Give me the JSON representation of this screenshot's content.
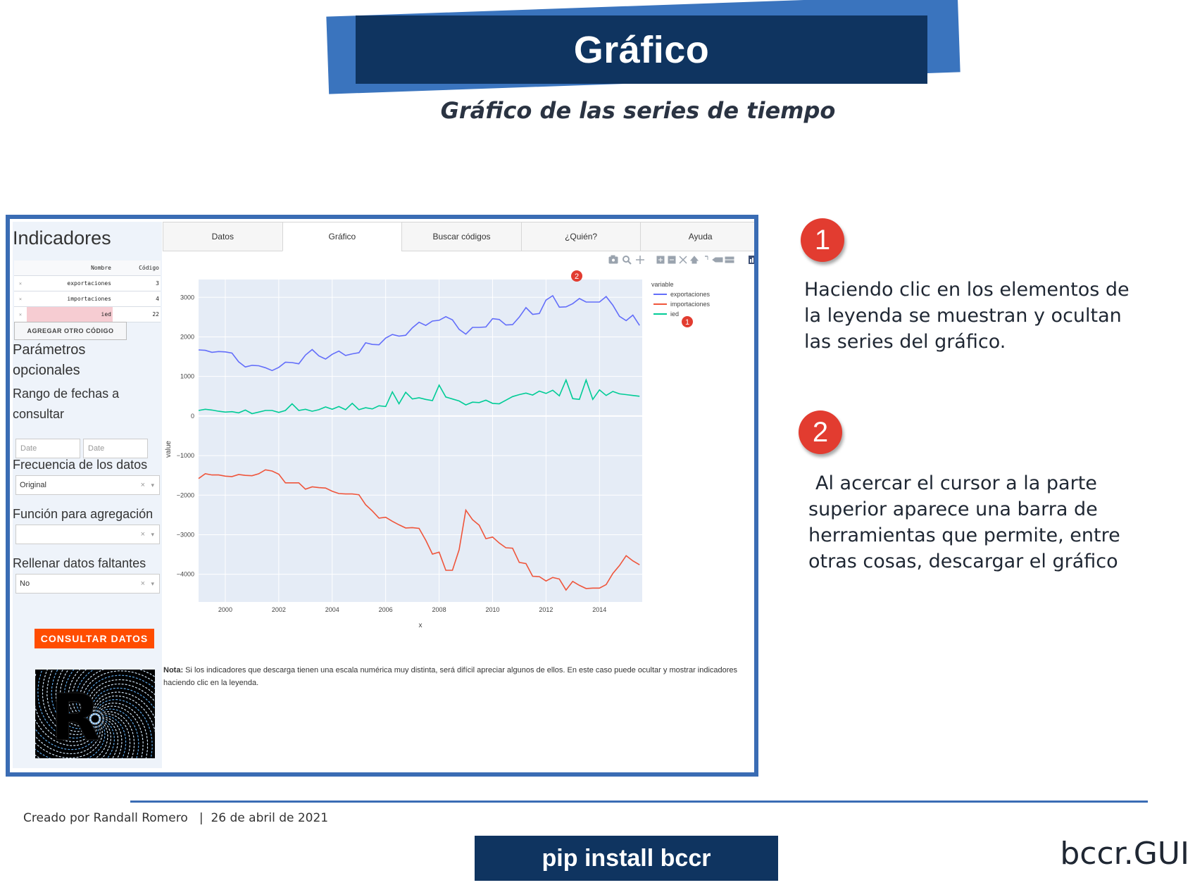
{
  "header": {
    "title": "Gráfico",
    "subtitle": "Gráfico de las series de tiempo"
  },
  "sidebar": {
    "heading": "Indicadores",
    "table": {
      "headers": [
        "Nombre",
        "Código"
      ],
      "rows": [
        {
          "remove": "×",
          "nombre": "exportaciones",
          "codigo": "3"
        },
        {
          "remove": "×",
          "nombre": "importaciones",
          "codigo": "4"
        },
        {
          "remove": "×",
          "nombre": "ied",
          "codigo": "22"
        }
      ]
    },
    "add_code_label": "AGREGAR OTRO CÓDIGO",
    "optional_params": "Parámetros opcionales",
    "date_range_label": "Rango de fechas a consultar",
    "date_start_placeholder": "Date",
    "date_end_placeholder": "Date",
    "frequency_label": "Frecuencia de los datos",
    "frequency_value": "Original",
    "aggregation_label": "Función para agregación",
    "aggregation_value": "",
    "fill_label": "Rellenar datos faltantes",
    "fill_value": "No",
    "clear_glyph": "×",
    "caret_glyph": "▾",
    "query_label": "CONSULTAR DATOS"
  },
  "tabs": [
    "Datos",
    "Gráfico",
    "Buscar códigos",
    "¿Quién?",
    "Ayuda"
  ],
  "active_tab": "Gráfico",
  "modebar_icons": [
    "camera-icon",
    "zoom-icon",
    "pan-icon",
    "zoom-in-icon",
    "zoom-out-icon",
    "autoscale-icon",
    "reset-axes-icon",
    "spike-lines-icon",
    "hover-closest-icon",
    "hover-compare-icon",
    "plotly-logo-icon"
  ],
  "callout_badges": {
    "modebar": "2",
    "legend": "1"
  },
  "note": {
    "bold": "Nota:",
    "text": " Si los indicadores que descarga tienen una escala numérica muy distinta, será difícil apreciar algunos de ellos. En este caso puede ocultar y mostrar indicadores haciendo clic en la leyenda."
  },
  "chart_data": {
    "type": "line",
    "xlabel": "x",
    "ylabel": "value",
    "legend_title": "variable",
    "xlim": [
      1999,
      2015.6
    ],
    "ylim": [
      -4700,
      3450
    ],
    "x_ticks": [
      "2000",
      "2002",
      "2004",
      "2006",
      "2008",
      "2010",
      "2012",
      "2014"
    ],
    "y_ticks": [
      "3000",
      "2000",
      "1000",
      "0",
      "−1000",
      "−2000",
      "−3000",
      "−4000"
    ],
    "grid": true,
    "legend_position": "top-right",
    "series": [
      {
        "name": "exportaciones",
        "color": "#636efa",
        "x": [
          1999.0,
          1999.25,
          1999.5,
          1999.75,
          2000.0,
          2000.25,
          2000.5,
          2000.75,
          2001.0,
          2001.25,
          2001.5,
          2001.75,
          2002.0,
          2002.25,
          2002.5,
          2002.75,
          2003.0,
          2003.25,
          2003.5,
          2003.75,
          2004.0,
          2004.25,
          2004.5,
          2004.75,
          2005.0,
          2005.25,
          2005.5,
          2005.75,
          2006.0,
          2006.25,
          2006.5,
          2006.75,
          2007.0,
          2007.25,
          2007.5,
          2007.75,
          2008.0,
          2008.25,
          2008.5,
          2008.75,
          2009.0,
          2009.25,
          2009.5,
          2009.75,
          2010.0,
          2010.25,
          2010.5,
          2010.75,
          2011.0,
          2011.25,
          2011.5,
          2011.75,
          2012.0,
          2012.25,
          2012.5,
          2012.75,
          2013.0,
          2013.25,
          2013.5,
          2013.75,
          2014.0,
          2014.25,
          2014.5,
          2014.75,
          2015.0,
          2015.25,
          2015.5
        ],
        "y": [
          1670,
          1660,
          1610,
          1630,
          1620,
          1590,
          1370,
          1240,
          1280,
          1270,
          1220,
          1150,
          1230,
          1360,
          1350,
          1320,
          1540,
          1680,
          1520,
          1440,
          1560,
          1640,
          1530,
          1570,
          1600,
          1850,
          1810,
          1800,
          1970,
          2060,
          2020,
          2040,
          2230,
          2370,
          2290,
          2400,
          2420,
          2510,
          2430,
          2190,
          2070,
          2240,
          2240,
          2250,
          2460,
          2440,
          2300,
          2310,
          2500,
          2740,
          2570,
          2590,
          2930,
          3040,
          2750,
          2760,
          2840,
          2970,
          2880,
          2880,
          2880,
          3020,
          2800,
          2520,
          2410,
          2550,
          2290
        ]
      },
      {
        "name": "importaciones",
        "color": "#ef553b",
        "x": [
          1999.0,
          1999.25,
          1999.5,
          1999.75,
          2000.0,
          2000.25,
          2000.5,
          2000.75,
          2001.0,
          2001.25,
          2001.5,
          2001.75,
          2002.0,
          2002.25,
          2002.5,
          2002.75,
          2003.0,
          2003.25,
          2003.5,
          2003.75,
          2004.0,
          2004.25,
          2004.5,
          2004.75,
          2005.0,
          2005.25,
          2005.5,
          2005.75,
          2006.0,
          2006.25,
          2006.5,
          2006.75,
          2007.0,
          2007.25,
          2007.5,
          2007.75,
          2008.0,
          2008.25,
          2008.5,
          2008.75,
          2009.0,
          2009.25,
          2009.5,
          2009.75,
          2010.0,
          2010.25,
          2010.5,
          2010.75,
          2011.0,
          2011.25,
          2011.5,
          2011.75,
          2012.0,
          2012.25,
          2012.5,
          2012.75,
          2013.0,
          2013.25,
          2013.5,
          2013.75,
          2014.0,
          2014.25,
          2014.5,
          2014.75,
          2015.0,
          2015.25,
          2015.5
        ],
        "y": [
          -1580,
          -1460,
          -1490,
          -1490,
          -1520,
          -1530,
          -1480,
          -1500,
          -1510,
          -1460,
          -1360,
          -1390,
          -1470,
          -1690,
          -1690,
          -1690,
          -1850,
          -1790,
          -1810,
          -1820,
          -1900,
          -1960,
          -1970,
          -1970,
          -1990,
          -2240,
          -2400,
          -2580,
          -2560,
          -2660,
          -2750,
          -2830,
          -2820,
          -2840,
          -3140,
          -3490,
          -3440,
          -3900,
          -3900,
          -3380,
          -2380,
          -2620,
          -2760,
          -3100,
          -3060,
          -3210,
          -3330,
          -3340,
          -3700,
          -3730,
          -4050,
          -4060,
          -4170,
          -4080,
          -4120,
          -4400,
          -4180,
          -4280,
          -4360,
          -4350,
          -4350,
          -4260,
          -3980,
          -3780,
          -3530,
          -3660,
          -3760
        ]
      },
      {
        "name": "ied",
        "color": "#00cc96",
        "x": [
          1999.0,
          1999.25,
          1999.5,
          1999.75,
          2000.0,
          2000.25,
          2000.5,
          2000.75,
          2001.0,
          2001.25,
          2001.5,
          2001.75,
          2002.0,
          2002.25,
          2002.5,
          2002.75,
          2003.0,
          2003.25,
          2003.5,
          2003.75,
          2004.0,
          2004.25,
          2004.5,
          2004.75,
          2005.0,
          2005.25,
          2005.5,
          2005.75,
          2006.0,
          2006.25,
          2006.5,
          2006.75,
          2007.0,
          2007.25,
          2007.5,
          2007.75,
          2008.0,
          2008.25,
          2008.5,
          2008.75,
          2009.0,
          2009.25,
          2009.5,
          2009.75,
          2010.0,
          2010.25,
          2010.5,
          2010.75,
          2011.0,
          2011.25,
          2011.5,
          2011.75,
          2012.0,
          2012.25,
          2012.5,
          2012.75,
          2013.0,
          2013.25,
          2013.5,
          2013.75,
          2014.0,
          2014.25,
          2014.5,
          2014.75,
          2015.0,
          2015.25,
          2015.5
        ],
        "y": [
          140,
          170,
          150,
          120,
          100,
          110,
          80,
          150,
          60,
          100,
          140,
          140,
          90,
          140,
          310,
          140,
          170,
          120,
          160,
          230,
          170,
          240,
          160,
          320,
          160,
          210,
          180,
          260,
          240,
          610,
          310,
          600,
          430,
          460,
          420,
          390,
          780,
          480,
          430,
          380,
          280,
          350,
          340,
          400,
          320,
          310,
          400,
          490,
          540,
          580,
          530,
          630,
          570,
          650,
          510,
          910,
          440,
          420,
          910,
          420,
          660,
          520,
          620,
          560,
          540,
          520,
          500
        ]
      }
    ]
  },
  "explain_1": {
    "badge": "1",
    "text": "Haciendo clic en los elementos de la leyenda se muestran y ocultan las series del gráfico."
  },
  "explain_2": {
    "badge": "2",
    "text": "Al acercar el cursor a la parte superior aparece una barra de herramientas que permite, entre otras cosas, descargar el gráfico"
  },
  "footer": {
    "credit": "Creado por Randall Romero   |  26 de abril de 2021",
    "pip": "pip install bccr",
    "brand": "bccr.GUI"
  }
}
